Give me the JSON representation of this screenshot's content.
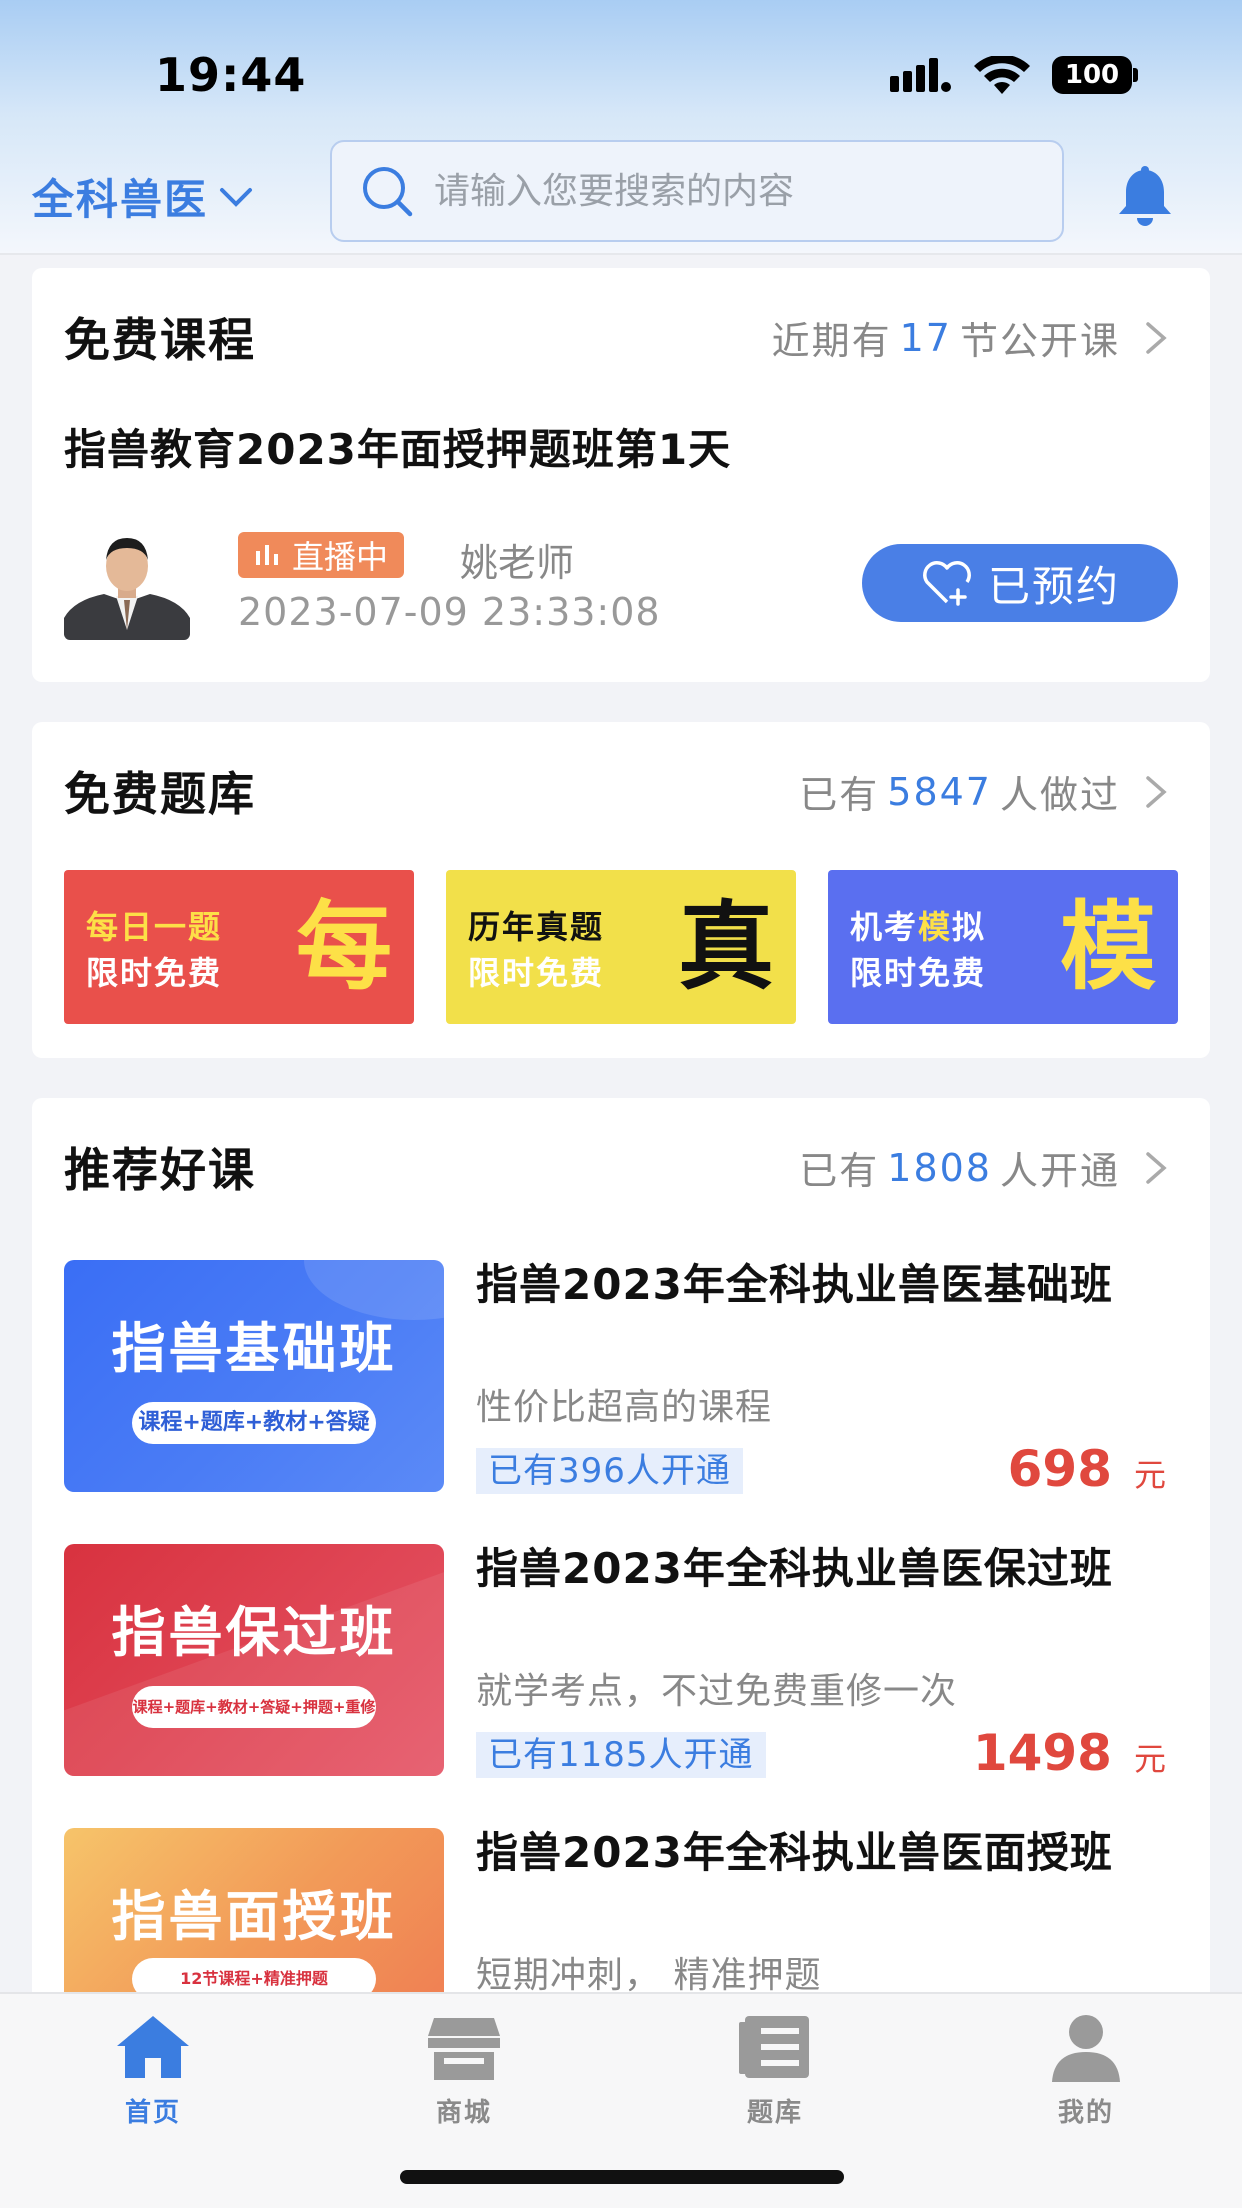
{
  "status_bar": {
    "time": "19:44",
    "battery": "100"
  },
  "header": {
    "category": "全科兽医",
    "search_placeholder": "请输入您要搜索的内容"
  },
  "free_courses": {
    "title": "免费课程",
    "more_prefix": "近期有",
    "more_count": "17",
    "more_suffix": "节公开课",
    "course_title": "指兽教育2023年面授押题班第1天",
    "live_label": "直播中",
    "teacher": "姚老师",
    "datetime": "2023-07-09 23:33:08",
    "reserved_label": "已预约"
  },
  "free_questions": {
    "title": "免费题库",
    "more_prefix": "已有",
    "more_count": "5847",
    "more_suffix": "人做过",
    "tiles": [
      {
        "line1": "每日一题",
        "line2": "限时免费",
        "big": "每",
        "bg": "#e9504b"
      },
      {
        "line1": "历年真题",
        "line2": "限时免费",
        "big": "真",
        "bg": "#f2e04a"
      },
      {
        "line1a": "机考",
        "line1b": "模",
        "line1c": "拟",
        "line2": "限时免费",
        "big": "模",
        "bg": "#5a6ff0"
      }
    ]
  },
  "recommended": {
    "title": "推荐好课",
    "more_prefix": "已有",
    "more_count": "1808",
    "more_suffix": "人开通",
    "items": [
      {
        "thumb_title": "指兽基础班",
        "thumb_pill": "课程+题库+教材+答疑",
        "name": "指兽2023年全科执业兽医基础班",
        "desc": "性价比超高的课程",
        "count": "已有396人开通",
        "price": "698",
        "unit": "元"
      },
      {
        "thumb_title": "指兽保过班",
        "thumb_pill": "课程+题库+教材+答疑+押题+重修",
        "name": "指兽2023年全科执业兽医保过班",
        "desc": "就学考点，不过免费重修一次",
        "count": "已有1185人开通",
        "price": "1498",
        "unit": "元"
      },
      {
        "thumb_title": "指兽面授班",
        "thumb_pill": "12节课程+精准押题",
        "name": "指兽2023年全科执业兽医面授班",
        "desc": "短期冲刺， 精准押题"
      }
    ]
  },
  "tabbar": {
    "tabs": [
      {
        "label": "首页",
        "active": true
      },
      {
        "label": "商城"
      },
      {
        "label": "题库"
      },
      {
        "label": "我的"
      }
    ],
    "active_color": "#3b7de0",
    "inactive_color": "#8a8a8a"
  }
}
